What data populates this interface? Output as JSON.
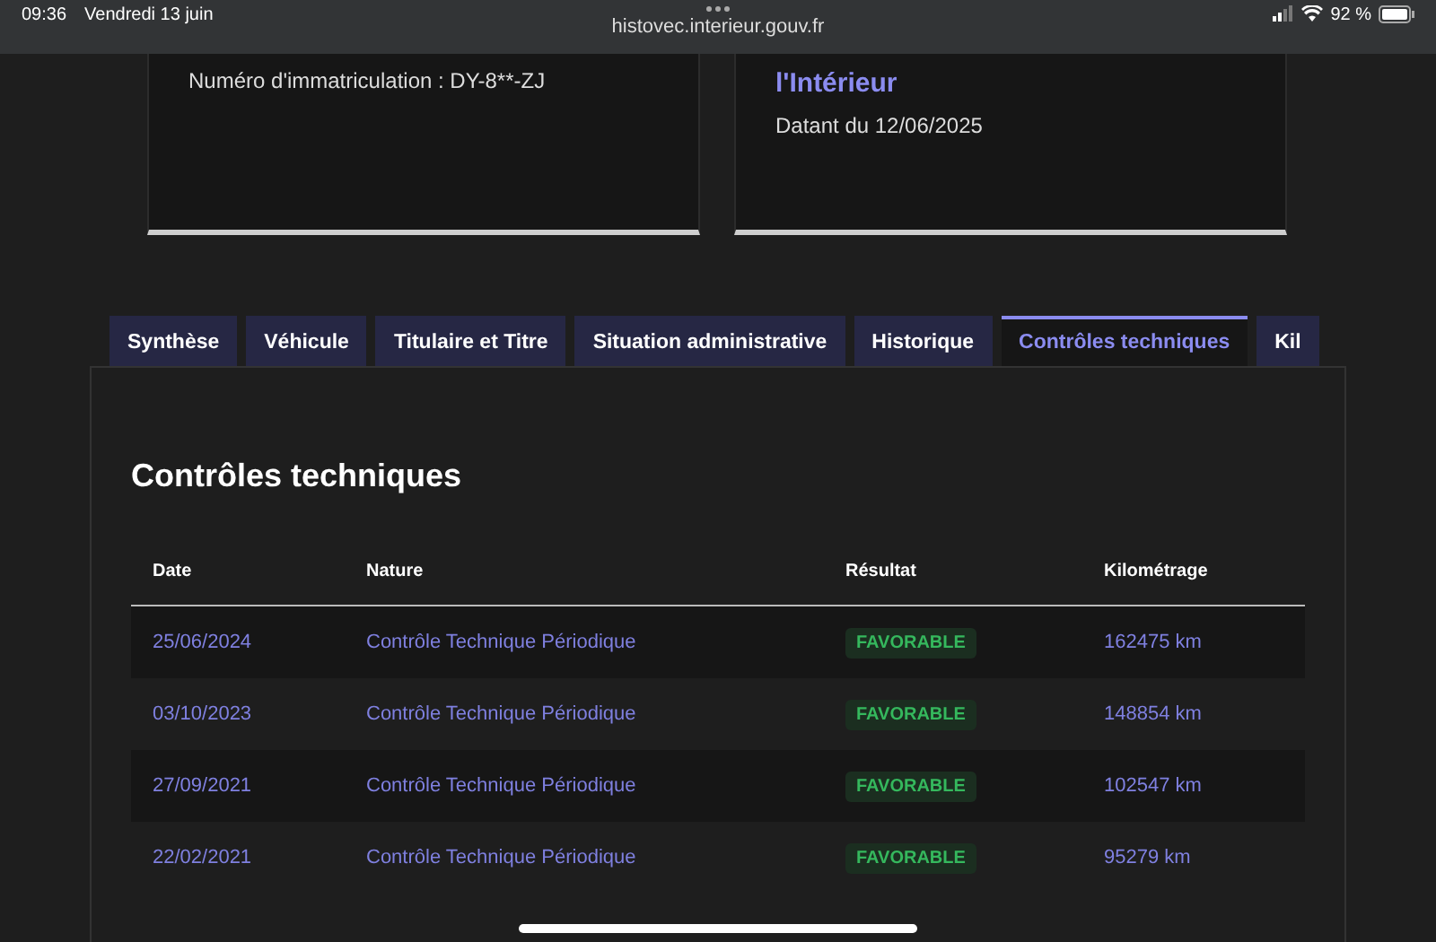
{
  "status_bar": {
    "time": "09:36",
    "date": "Vendredi 13 juin",
    "url": "histovec.interieur.gouv.fr",
    "battery": "92 %"
  },
  "cards": [
    {
      "text": "Numéro d'immatriculation : DY-8**-ZJ"
    },
    {
      "title": "l'Intérieur",
      "text": "Datant du 12/06/2025"
    }
  ],
  "tabs": [
    {
      "label": "Synthèse",
      "selected": false
    },
    {
      "label": "Véhicule",
      "selected": false
    },
    {
      "label": "Titulaire et Titre",
      "selected": false
    },
    {
      "label": "Situation administrative",
      "selected": false
    },
    {
      "label": "Historique",
      "selected": false
    },
    {
      "label": "Contrôles techniques",
      "selected": true
    },
    {
      "label": "Kil",
      "selected": false
    }
  ],
  "section_title": "Contrôles techniques",
  "table": {
    "columns": [
      "Date",
      "Nature",
      "Résultat",
      "Kilométrage"
    ],
    "rows": [
      {
        "date": "25/06/2024",
        "nature": "Contrôle Technique Périodique",
        "result": "FAVORABLE",
        "mileage": "162475 km"
      },
      {
        "date": "03/10/2023",
        "nature": "Contrôle Technique Périodique",
        "result": "FAVORABLE",
        "mileage": "148854 km"
      },
      {
        "date": "27/09/2021",
        "nature": "Contrôle Technique Périodique",
        "result": "FAVORABLE",
        "mileage": "102547 km"
      },
      {
        "date": "22/02/2021",
        "nature": "Contrôle Technique Périodique",
        "result": "FAVORABLE",
        "mileage": "95279 km"
      }
    ]
  }
}
